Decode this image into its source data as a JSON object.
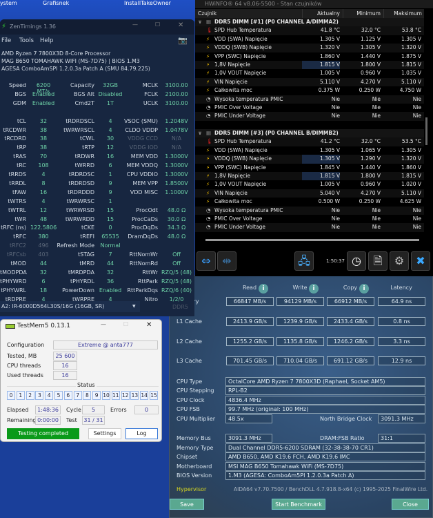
{
  "desktop": {
    "icons": [
      "ystem",
      "Grafisnek",
      "InstallTakeOwner"
    ]
  },
  "zen": {
    "title": "ZenTimings 1.36",
    "menu": [
      "File",
      "Tools",
      "Help"
    ],
    "cpu": "AMD Ryzen 7 7800X3D 8-Core Processor",
    "board": "MAG B650 TOMAHAWK WIFI (MS-7D75) | BIOS 1.M3",
    "agesa": "AGESA ComboAmSPI 1.2.0.3a Patch A (SMU 84.79.225)",
    "rows": [
      [
        [
          "Speed",
          "6200 MT/s"
        ],
        [
          "Capacity",
          "32GB"
        ],
        [
          "MCLK",
          "3100.00"
        ]
      ],
      [
        [
          "BGS",
          "Enabled"
        ],
        [
          "BGS Alt",
          "Disabled"
        ],
        [
          "FCLK",
          "2100.00"
        ]
      ],
      [
        [
          "GDM",
          "Enabled"
        ],
        [
          "Cmd2T",
          "1T"
        ],
        [
          "UCLK",
          "3100.00"
        ]
      ],
      null,
      [
        [
          "tCL",
          "32"
        ],
        [
          "tRDRDSCL",
          "4"
        ],
        [
          "VSOC (SMU)",
          "1.2048V"
        ]
      ],
      [
        [
          "tRCDWR",
          "38"
        ],
        [
          "tWRWRSCL",
          "4"
        ],
        [
          "CLDO VDDP",
          "1.0478V"
        ]
      ],
      [
        [
          "tRCDRD",
          "38"
        ],
        [
          "tCWL",
          "30"
        ],
        [
          "VDDG CCD",
          "N/A",
          "dim"
        ]
      ],
      [
        [
          "tRP",
          "38"
        ],
        [
          "tRTP",
          "12"
        ],
        [
          "VDDG IOD",
          "N/A",
          "dim"
        ]
      ],
      [
        [
          "tRAS",
          "70"
        ],
        [
          "tRDWR",
          "16"
        ],
        [
          "MEM VDD",
          "1.3000V"
        ]
      ],
      [
        [
          "tRC",
          "108"
        ],
        [
          "tWRRD",
          "6"
        ],
        [
          "MEM VDDQ",
          "1.3000V"
        ]
      ],
      [
        [
          "tRRDS",
          "4"
        ],
        [
          "tRDRDSC",
          "1"
        ],
        [
          "CPU VDDIO",
          "1.3000V"
        ]
      ],
      [
        [
          "tRRDL",
          "8"
        ],
        [
          "tRDRDSD",
          "9"
        ],
        [
          "MEM VPP",
          "1.8500V"
        ]
      ],
      [
        [
          "tFAW",
          "16"
        ],
        [
          "tRDRDDD",
          "9"
        ],
        [
          "VDD MISC",
          "1.1000V"
        ]
      ],
      [
        [
          "tWTRS",
          "4"
        ],
        [
          "tWRWRSC",
          "1"
        ],
        null
      ],
      [
        [
          "tWTRL",
          "12"
        ],
        [
          "tWRWRSD",
          "15"
        ],
        [
          "ProcOdt",
          "48.0 Ω"
        ]
      ],
      [
        [
          "tWR",
          "48"
        ],
        [
          "tWRWRDD",
          "15"
        ],
        [
          "ProcCaDs",
          "30.0 Ω"
        ]
      ],
      [
        [
          "tRFC (ns)",
          "122.5806"
        ],
        [
          "tCKE",
          "0"
        ],
        [
          "ProcDqDs",
          "34.3 Ω"
        ]
      ],
      [
        [
          "tRFC",
          "380"
        ],
        [
          "tREFI",
          "65535"
        ],
        [
          "DramDqDs",
          "48.0 Ω"
        ]
      ],
      [
        [
          "tRFC2",
          "496",
          "dim"
        ],
        [
          "Refresh Mode",
          "Normal"
        ],
        null
      ],
      [
        [
          "tRFCsb",
          "403",
          "dim"
        ],
        [
          "tSTAG",
          "7"
        ],
        [
          "RttNomWr",
          "Off"
        ]
      ],
      [
        [
          "tMOD",
          "44"
        ],
        [
          "tMRD",
          "44"
        ],
        [
          "RttNomRd",
          "Off"
        ]
      ],
      [
        [
          "tMODPDA",
          "32"
        ],
        [
          "tMRDPDA",
          "32"
        ],
        [
          "RttWr",
          "RZQ/5 (48)"
        ]
      ],
      [
        [
          "tPHYWRD",
          "6"
        ],
        [
          "tPHYRDL",
          "36"
        ],
        [
          "RttPark",
          "RZQ/5 (48)"
        ]
      ],
      [
        [
          "tPHYWRL",
          "18"
        ],
        [
          "PowerDown",
          "Enabled"
        ],
        [
          "RttParkDqs",
          "RZQ/6 (40)"
        ]
      ],
      [
        [
          "tRDPRE",
          "4"
        ],
        [
          "tWRPRE",
          "4"
        ],
        [
          "Nitro",
          "1/2/0"
        ]
      ]
    ],
    "dimm_select": "A2: IR-6000D564L30S/16G (16GB, SR)",
    "ddr_label": "DDR5"
  },
  "hwinfo": {
    "title": "HWiNFO® 64 v8.06-5500 - Stan czujników",
    "columns": [
      "Czujnik",
      "Aktualny",
      "Minimum",
      "Maksimum"
    ],
    "groups": [
      {
        "name": "DDR5 DIMM [#1] (P0 CHANNEL A/DIMMA2)",
        "rows": [
          [
            "temp",
            "SPD Hub Temperatura",
            "41.8 °C",
            "32.0 °C",
            "53.8 °C"
          ],
          [
            "volt",
            "VDD (SWA) Napięcie",
            "1.305 V",
            "1.125 V",
            "1.305 V"
          ],
          [
            "volt",
            "VDDQ (SWB) Napięcie",
            "1.320 V",
            "1.305 V",
            "1.320 V"
          ],
          [
            "volt",
            "VPP (SWC) Napięcie",
            "1.860 V",
            "1.440 V",
            "1.875 V"
          ],
          [
            "volt",
            "1,8V Napięcie",
            "1.815 V",
            "1.800 V",
            "1.815 V"
          ],
          [
            "volt",
            "1,0V VOUT Napięcie",
            "1.005 V",
            "0.960 V",
            "1.035 V"
          ],
          [
            "volt",
            "VIN Napięcie",
            "5.110 V",
            "4.270 V",
            "5.110 V"
          ],
          [
            "volt",
            "Całkowita moc",
            "0.375 W",
            "0.250 W",
            "4.750 W"
          ],
          [
            "clock",
            "Wysoka temperatura PMIC",
            "Nie",
            "Nie",
            "Nie"
          ],
          [
            "clock",
            "PMIC Over Voltage",
            "Nie",
            "Nie",
            "Nie"
          ],
          [
            "clock",
            "PMIC Under Voltage",
            "Nie",
            "Nie",
            "Nie"
          ]
        ]
      },
      {
        "name": "DDR5 DIMM [#3] (P0 CHANNEL B/DIMMB2)",
        "rows": [
          [
            "temp",
            "SPD Hub Temperatura",
            "41.2 °C",
            "32.0 °C",
            "53.5 °C"
          ],
          [
            "volt",
            "VDD (SWA) Napięcie",
            "1.305 V",
            "1.065 V",
            "1.305 V"
          ],
          [
            "volt",
            "VDDQ (SWB) Napięcie",
            "1.305 V",
            "1.290 V",
            "1.320 V"
          ],
          [
            "volt",
            "VPP (SWC) Napięcie",
            "1.845 V",
            "1.440 V",
            "1.860 V"
          ],
          [
            "volt",
            "1,8V Napięcie",
            "1.815 V",
            "1.800 V",
            "1.815 V"
          ],
          [
            "volt",
            "1,0V VOUT Napięcie",
            "1.005 V",
            "0.960 V",
            "1.020 V"
          ],
          [
            "volt",
            "VIN Napięcie",
            "5.040 V",
            "4.270 V",
            "5.110 V"
          ],
          [
            "volt",
            "Całkowita moc",
            "0.500 W",
            "0.250 W",
            "4.625 W"
          ],
          [
            "clock",
            "Wysoka temperatura PMIC",
            "Nie",
            "Nie",
            "Nie"
          ],
          [
            "clock",
            "PMIC Over Voltage",
            "Nie",
            "Nie",
            "Nie"
          ],
          [
            "clock",
            "PMIC Under Voltage",
            "Nie",
            "Nie",
            "Nie"
          ]
        ]
      }
    ],
    "timer": "1:50:37"
  },
  "aida": {
    "headers": [
      "Read",
      "Write",
      "Copy",
      "Latency"
    ],
    "bench": [
      [
        "Memory",
        "66847 MB/s",
        "94129 MB/s",
        "66912 MB/s",
        "64.9 ns"
      ],
      [
        "L1 Cache",
        "2413.9 GB/s",
        "1239.9 GB/s",
        "2433.4 GB/s",
        "0.8 ns"
      ],
      [
        "L2 Cache",
        "1255.2 GB/s",
        "1135.8 GB/s",
        "1246.2 GB/s",
        "3.3 ns"
      ],
      [
        "L3 Cache",
        "701.45 GB/s",
        "710.04 GB/s",
        "691.12 GB/s",
        "12.9 ns"
      ]
    ],
    "cpu_type_label": "CPU Type",
    "cpu_type": "OctalCore AMD Ryzen 7 7800X3D  (Raphael, Socket AM5)",
    "stepping_label": "CPU Stepping",
    "stepping": "RPL-B2",
    "clock_label": "CPU Clock",
    "clock": "4836.4 MHz",
    "fsb_label": "CPU FSB",
    "fsb": "99.7 MHz  (original: 100 MHz)",
    "mult_label": "CPU Multiplier",
    "mult": "48.5x",
    "nb_label": "North Bridge Clock",
    "nb": "3091.3 MHz",
    "membus_label": "Memory Bus",
    "membus": "3091.3 MHz",
    "ratio_label": "DRAM:FSB Ratio",
    "ratio": "31:1",
    "memtype_label": "Memory Type",
    "memtype": "Dual Channel DDR5-6200 SDRAM  (32-38-38-70 CR1)",
    "chipset_label": "Chipset",
    "chipset": "AMD B650, AMD K19.6 FCH, AMD K19.6 IMC",
    "mobo_label": "Motherboard",
    "mobo": "MSI MAG B650 Tomahawk WiFi (MS-7D75)",
    "bios_label": "BIOS Version",
    "bios": "1.M3  (AGESA: ComboAm5PI 1.2.0.3a Patch A)",
    "hypervisor": "Hypervisor",
    "footer": "AIDA64 v7.70.7500 / BenchDLL 4.7.918.8-x64  (c) 1995-2025 FinalWire Ltd.",
    "save": "Save",
    "start": "Start Benchmark",
    "close": "Close"
  },
  "testmem": {
    "title": "TestMem5  0.13.1",
    "config_label": "Configuration",
    "config": "Extreme @ anta777",
    "tested_label": "Tested, MB",
    "tested": "25 600",
    "cpu_threads_label": "CPU threads",
    "cpu_threads": "16",
    "used_threads_label": "Used threads",
    "used_threads": "16",
    "status_label": "Status",
    "threads": [
      "0",
      "1",
      "2",
      "3",
      "4",
      "5",
      "6",
      "7",
      "8",
      "9",
      "10",
      "11",
      "12",
      "13",
      "14",
      "15"
    ],
    "elapsed_label": "Elapsed",
    "elapsed": "1:48:36",
    "cycle_label": "Cycle",
    "cycle": "5",
    "errors_label": "Errors",
    "errors": "0",
    "remaining_label": "Remaining",
    "remaining": "0:00:00",
    "test_label": "Test",
    "test": "31 / 31",
    "completed": "Testing completed",
    "settings": "Settings",
    "log": "Log"
  }
}
